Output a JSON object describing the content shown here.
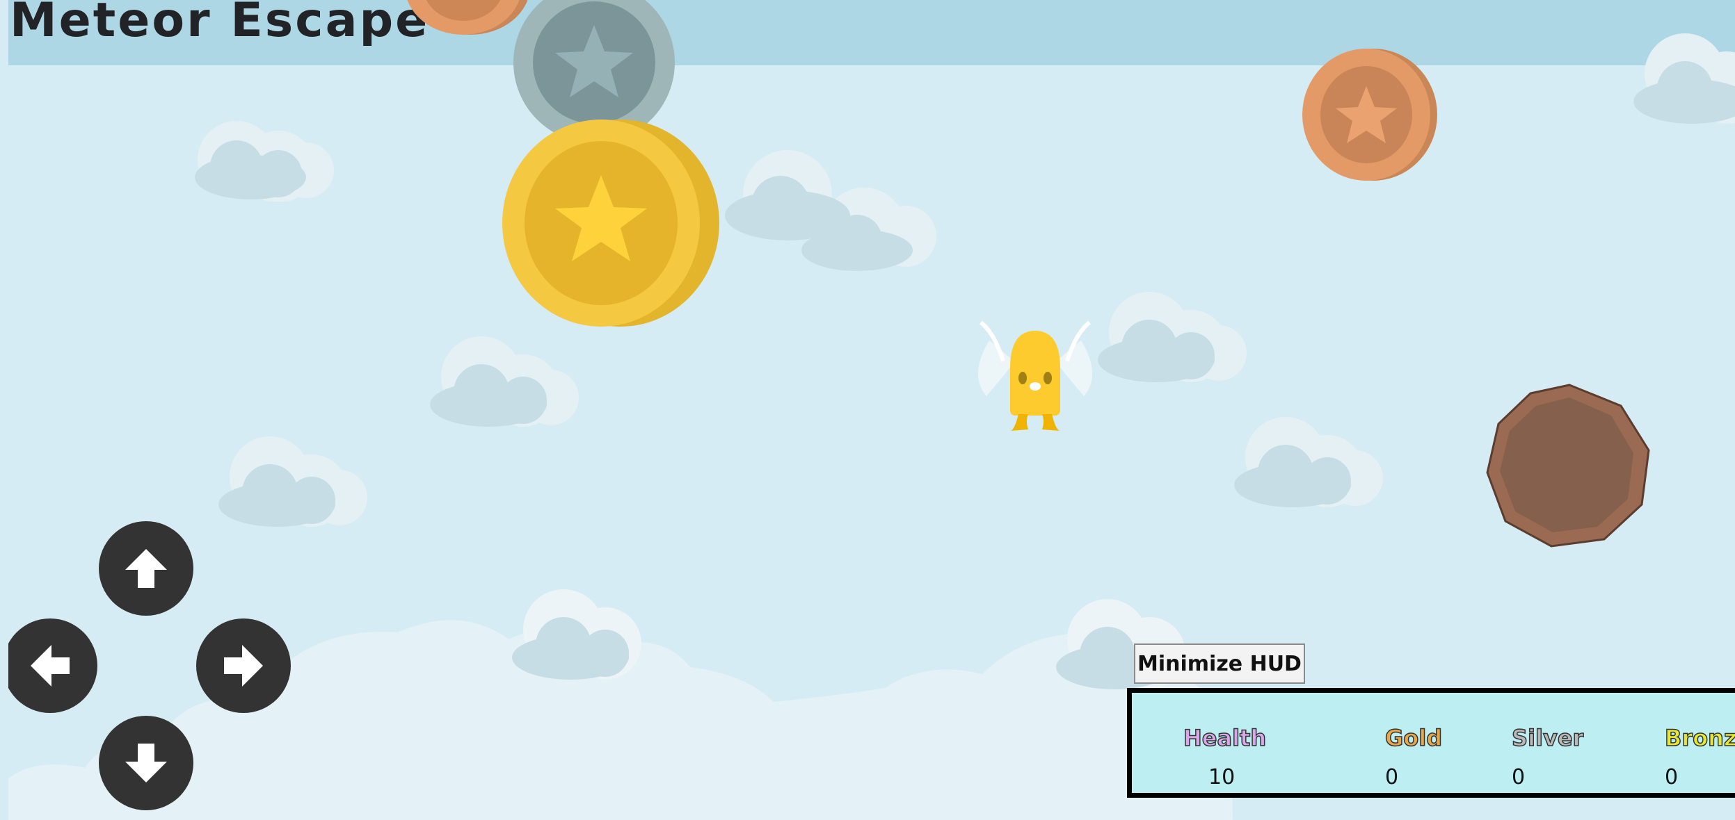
{
  "game": {
    "title": "Meteor Escape"
  },
  "controls": {
    "up": "arrow-up-icon",
    "left": "arrow-left-icon",
    "right": "arrow-right-icon",
    "down": "arrow-down-icon"
  },
  "hud": {
    "toggle_label": "Minimize HUD",
    "stats": [
      {
        "label": "Health",
        "value": "10",
        "color": "#d9a8e8"
      },
      {
        "label": "Gold",
        "value": "0",
        "color": "#e6a84a"
      },
      {
        "label": "Silver",
        "value": "0",
        "color": "#b9b9b9"
      },
      {
        "label": "Bronze",
        "value": "0",
        "color": "#e8e832"
      }
    ]
  },
  "colors": {
    "sky": "#d6ecf4",
    "top_band": "#aed7e6",
    "gold_coin": "#f5c842",
    "silver_coin": "#8aa7ab",
    "bronze_coin": "#e39a66",
    "meteor": "#8a6350",
    "player": "#fecb2e"
  }
}
